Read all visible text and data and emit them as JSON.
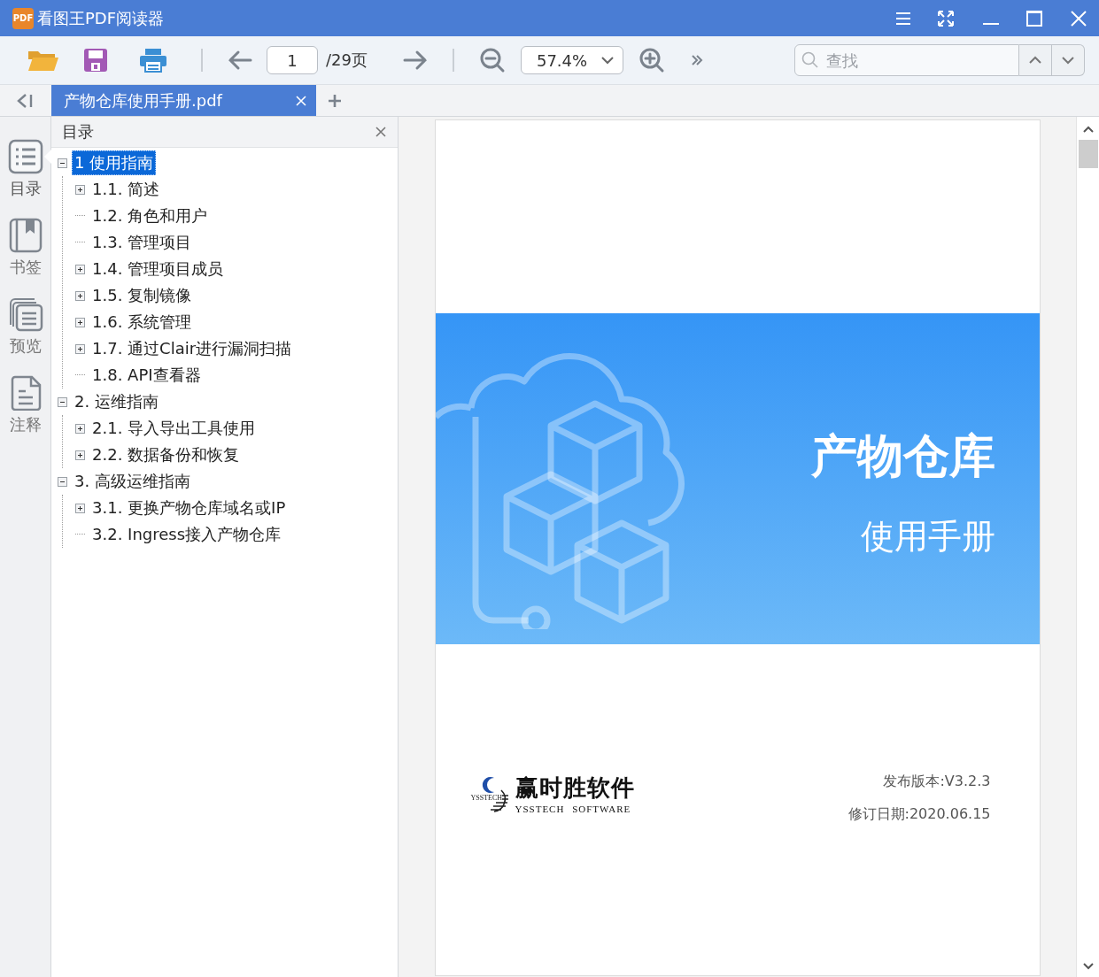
{
  "window": {
    "title": "看图王PDF阅读器",
    "logo_text": "PDF"
  },
  "toolbar": {
    "page_input": "1",
    "page_total": "/29页",
    "zoom": "57.4%",
    "search": {
      "placeholder": "查找"
    }
  },
  "tabs": [
    {
      "label": "产物仓库使用手册.pdf",
      "selected": true
    }
  ],
  "sidebar": {
    "items": [
      {
        "label": "目录",
        "kind": "contents",
        "selected": true
      },
      {
        "label": "书签",
        "kind": "bookmarks",
        "selected": false
      },
      {
        "label": "预览",
        "kind": "preview",
        "selected": false
      },
      {
        "label": "注释",
        "kind": "annotations",
        "selected": false
      }
    ]
  },
  "toc": {
    "title": "目录",
    "items": [
      {
        "label": "1 使用指南",
        "selected": true,
        "expanded": true,
        "children": [
          {
            "label": "1.1. 简述",
            "selected": false,
            "expanded": false
          },
          {
            "label": "1.2. 角色和用户",
            "selected": false
          },
          {
            "label": "1.3. 管理项目",
            "selected": false
          },
          {
            "label": "1.4. 管理项目成员",
            "selected": false,
            "expanded": false
          },
          {
            "label": "1.5. 复制镜像",
            "selected": false,
            "expanded": false
          },
          {
            "label": "1.6. 系统管理",
            "selected": false,
            "expanded": false
          },
          {
            "label": "1.7. 通过Clair进行漏洞扫描",
            "selected": false,
            "expanded": false
          },
          {
            "label": "1.8. API查看器",
            "selected": false
          }
        ]
      },
      {
        "label": "2. 运维指南",
        "selected": false,
        "expanded": true,
        "children": [
          {
            "label": "2.1. 导入导出工具使用",
            "selected": false,
            "expanded": false
          },
          {
            "label": "2.2. 数据备份和恢复",
            "selected": false,
            "expanded": false
          }
        ]
      },
      {
        "label": "3. 高级运维指南",
        "selected": false,
        "expanded": true,
        "children": [
          {
            "label": "3.1. 更换产物仓库域名或IP",
            "selected": false,
            "expanded": false
          },
          {
            "label": "3.2. Ingress接入产物仓库",
            "selected": false
          }
        ]
      }
    ]
  },
  "document": {
    "cover_title": "产物仓库",
    "cover_subtitle": "使用手册",
    "logo_mark_text": "YSSTECH",
    "logo_name": "赢时胜软件",
    "logo_english": "YSSTECH SOFTWARE",
    "version": "发布版本:V3.2.3",
    "revision_date": "修订日期:2020.06.15"
  }
}
